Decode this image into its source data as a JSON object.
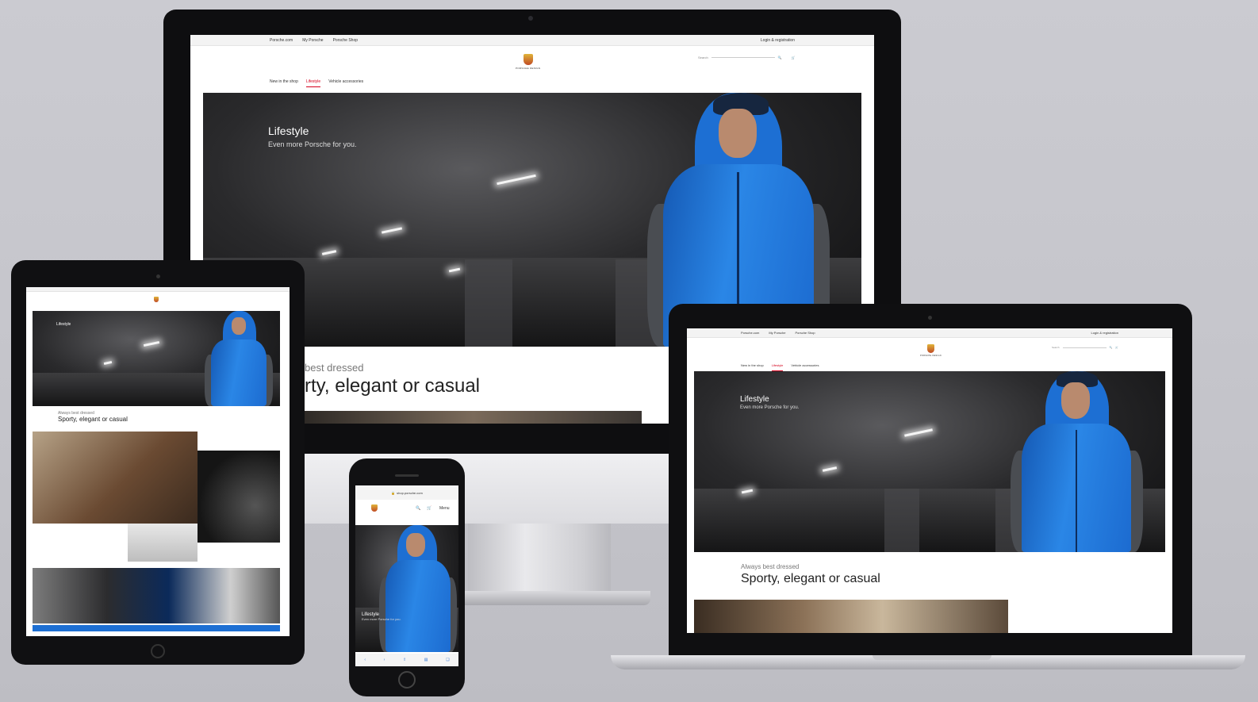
{
  "site": {
    "top_links": [
      "Porsche.com",
      "My Porsche",
      "Porsche Shop"
    ],
    "login": "Login & registration",
    "search_placeholder": "Search",
    "nav": [
      "New in the shop",
      "Lifestyle",
      "Vehicle accessories"
    ],
    "active_nav": "Lifestyle",
    "brand": "PORSCHE DESIGN",
    "hero_title": "Lifestyle",
    "hero_subtitle": "Even more Porsche for you.",
    "kicker": "Always best dressed",
    "headline": "Sporty, elegant or casual",
    "imac_kicker_visible": "best dressed",
    "imac_headline_visible": "rty, elegant or casual",
    "phone_url": "shop.porsche.com",
    "phone_menu": "Menu"
  },
  "colors": {
    "accent": "#d5001c",
    "jacket_blue": "#1d6fd3",
    "device_black": "#0e0e10",
    "background": "#c8c8ce"
  }
}
